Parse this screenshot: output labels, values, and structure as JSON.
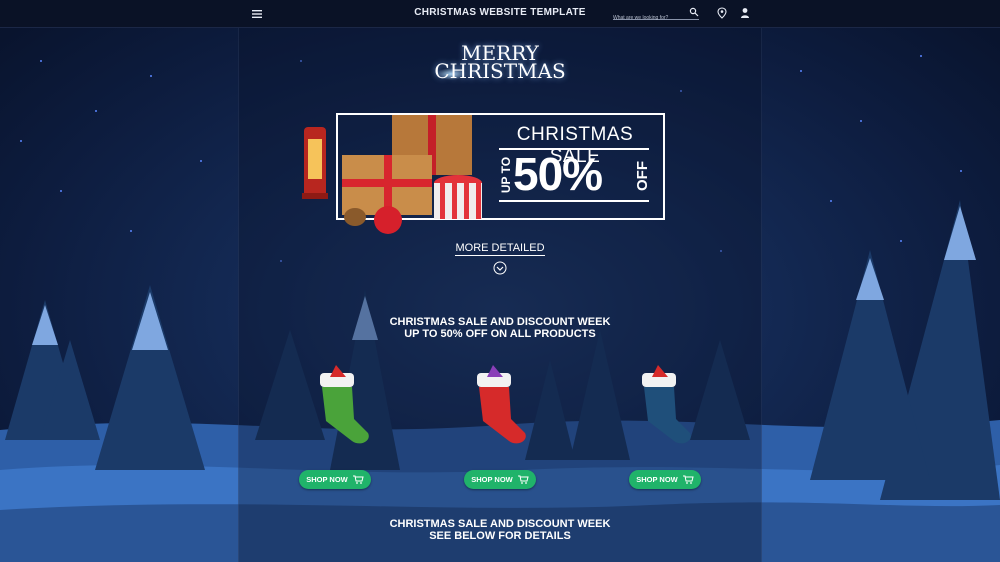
{
  "header": {
    "site_title": "CHRISTMAS WEBSITE TEMPLATE",
    "search_placeholder": "What are we looking for?"
  },
  "hero": {
    "greeting_line1": "MERRY",
    "greeting_line2": "CHRISTMAS",
    "sale_title": "CHRISTMAS SALE",
    "sale_upto": "UP TO",
    "sale_percent": "50%",
    "sale_off": "OFF",
    "more_link": "MORE DETAILED"
  },
  "promo": {
    "line1": "CHRISTMAS SALE AND DISCOUNT WEEK",
    "line2": "UP TO 50% OFF ON ALL PRODUCTS"
  },
  "products": [
    {
      "button_label": "SHOP NOW",
      "sock_color": "#4aa33a"
    },
    {
      "button_label": "SHOP NOW",
      "sock_color": "#d62a2a"
    },
    {
      "button_label": "SHOP NOW",
      "sock_color": "#1f4f7a"
    }
  ],
  "footer_promo": {
    "line1": "CHRISTMAS SALE AND DISCOUNT WEEK",
    "line2": "SEE BELOW FOR DETAILS"
  },
  "colors": {
    "accent_green": "#20b36a",
    "background": "#0c1630"
  },
  "icons": [
    "menu-icon",
    "search-icon",
    "location-pin-icon",
    "user-icon",
    "chevron-down-icon",
    "cart-icon"
  ]
}
